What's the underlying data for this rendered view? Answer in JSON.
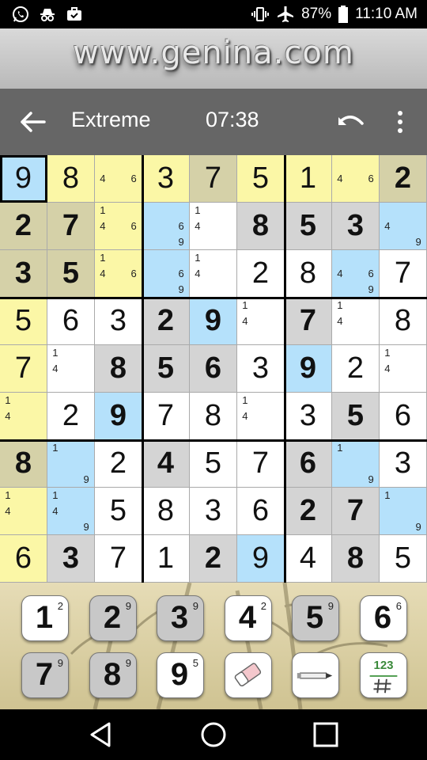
{
  "status_bar": {
    "battery": "87%",
    "time": "11:10 AM",
    "left_icons": [
      "whatsapp-icon",
      "incognito-icon",
      "briefcase-icon"
    ],
    "right_icons": [
      "vibrate-icon",
      "airplane-mode-icon",
      "battery-icon"
    ]
  },
  "banner": {
    "text": "www.genina.com"
  },
  "toolbar": {
    "level": "Extreme",
    "timer": "07:38"
  },
  "colors": {
    "yellow": "#fbf7a6",
    "olive": "#d5d1a8",
    "blue": "#b5e1fb",
    "gray": "#d4d4d4",
    "white": "#ffffff",
    "toolbar": "#666666",
    "selected_border": "#000000"
  },
  "board": {
    "selected": [
      0,
      0
    ],
    "rows": [
      [
        {
          "v": "9",
          "bg": "blue"
        },
        {
          "v": "8",
          "bg": "yellow"
        },
        {
          "n": [
            "4",
            "6"
          ],
          "bg": "yellow"
        },
        {
          "v": "3",
          "bg": "yellow"
        },
        {
          "v": "7",
          "bg": "olive"
        },
        {
          "v": "5",
          "bg": "yellow"
        },
        {
          "v": "1",
          "bg": "yellow"
        },
        {
          "n": [
            "4",
            "6"
          ],
          "bg": "yellow"
        },
        {
          "v": "2",
          "bg": "olive",
          "g": true
        }
      ],
      [
        {
          "v": "2",
          "bg": "olive",
          "g": true
        },
        {
          "v": "7",
          "bg": "olive",
          "g": true
        },
        {
          "n": [
            "1",
            "4",
            "6"
          ],
          "bg": "yellow"
        },
        {
          "n": [
            "6",
            "9"
          ],
          "bg": "blue"
        },
        {
          "n": [
            "1",
            "4"
          ],
          "bg": "white"
        },
        {
          "v": "8",
          "bg": "gray",
          "g": true
        },
        {
          "v": "5",
          "bg": "gray",
          "g": true
        },
        {
          "v": "3",
          "bg": "gray",
          "g": true
        },
        {
          "n": [
            "4",
            "9"
          ],
          "bg": "blue"
        }
      ],
      [
        {
          "v": "3",
          "bg": "olive",
          "g": true
        },
        {
          "v": "5",
          "bg": "olive",
          "g": true
        },
        {
          "n": [
            "1",
            "4",
            "6"
          ],
          "bg": "yellow"
        },
        {
          "n": [
            "6",
            "9"
          ],
          "bg": "blue"
        },
        {
          "n": [
            "1",
            "4"
          ],
          "bg": "white"
        },
        {
          "v": "2",
          "bg": "white"
        },
        {
          "v": "8",
          "bg": "white"
        },
        {
          "n": [
            "4",
            "6",
            "9"
          ],
          "bg": "blue"
        },
        {
          "v": "7",
          "bg": "white"
        }
      ],
      [
        {
          "v": "5",
          "bg": "yellow"
        },
        {
          "v": "6",
          "bg": "white"
        },
        {
          "v": "3",
          "bg": "white"
        },
        {
          "v": "2",
          "bg": "gray",
          "g": true
        },
        {
          "v": "9",
          "bg": "blue",
          "g": true
        },
        {
          "n": [
            "1",
            "4"
          ],
          "bg": "white"
        },
        {
          "v": "7",
          "bg": "gray",
          "g": true
        },
        {
          "n": [
            "1",
            "4"
          ],
          "bg": "white"
        },
        {
          "v": "8",
          "bg": "white"
        }
      ],
      [
        {
          "v": "7",
          "bg": "yellow"
        },
        {
          "n": [
            "1",
            "4"
          ],
          "bg": "white"
        },
        {
          "v": "8",
          "bg": "gray",
          "g": true
        },
        {
          "v": "5",
          "bg": "gray",
          "g": true
        },
        {
          "v": "6",
          "bg": "gray",
          "g": true
        },
        {
          "v": "3",
          "bg": "white"
        },
        {
          "v": "9",
          "bg": "blue",
          "g": true
        },
        {
          "v": "2",
          "bg": "white"
        },
        {
          "n": [
            "1",
            "4"
          ],
          "bg": "white"
        }
      ],
      [
        {
          "n": [
            "1",
            "4"
          ],
          "bg": "yellow"
        },
        {
          "v": "2",
          "bg": "white"
        },
        {
          "v": "9",
          "bg": "blue",
          "g": true
        },
        {
          "v": "7",
          "bg": "white"
        },
        {
          "v": "8",
          "bg": "white"
        },
        {
          "n": [
            "1",
            "4"
          ],
          "bg": "white"
        },
        {
          "v": "3",
          "bg": "white"
        },
        {
          "v": "5",
          "bg": "gray",
          "g": true
        },
        {
          "v": "6",
          "bg": "white"
        }
      ],
      [
        {
          "v": "8",
          "bg": "olive",
          "g": true
        },
        {
          "n": [
            "1",
            "9"
          ],
          "bg": "blue"
        },
        {
          "v": "2",
          "bg": "white"
        },
        {
          "v": "4",
          "bg": "gray",
          "g": true
        },
        {
          "v": "5",
          "bg": "white"
        },
        {
          "v": "7",
          "bg": "white"
        },
        {
          "v": "6",
          "bg": "gray",
          "g": true
        },
        {
          "n": [
            "1",
            "9"
          ],
          "bg": "blue"
        },
        {
          "v": "3",
          "bg": "white"
        }
      ],
      [
        {
          "n": [
            "1",
            "4"
          ],
          "bg": "yellow"
        },
        {
          "n": [
            "1",
            "4",
            "9"
          ],
          "bg": "blue"
        },
        {
          "v": "5",
          "bg": "white"
        },
        {
          "v": "8",
          "bg": "white"
        },
        {
          "v": "3",
          "bg": "white"
        },
        {
          "v": "6",
          "bg": "white"
        },
        {
          "v": "2",
          "bg": "gray",
          "g": true
        },
        {
          "v": "7",
          "bg": "gray",
          "g": true
        },
        {
          "n": [
            "1",
            "9"
          ],
          "bg": "blue"
        }
      ],
      [
        {
          "v": "6",
          "bg": "yellow"
        },
        {
          "v": "3",
          "bg": "gray",
          "g": true
        },
        {
          "v": "7",
          "bg": "white"
        },
        {
          "v": "1",
          "bg": "white"
        },
        {
          "v": "2",
          "bg": "gray",
          "g": true
        },
        {
          "v": "9",
          "bg": "blue"
        },
        {
          "v": "4",
          "bg": "white"
        },
        {
          "v": "8",
          "bg": "gray",
          "g": true
        },
        {
          "v": "5",
          "bg": "white"
        }
      ]
    ]
  },
  "keypad": {
    "digits": [
      {
        "d": "1",
        "c": "2",
        "dim": false
      },
      {
        "d": "2",
        "c": "9",
        "dim": true
      },
      {
        "d": "3",
        "c": "9",
        "dim": true
      },
      {
        "d": "4",
        "c": "2",
        "dim": false
      },
      {
        "d": "5",
        "c": "9",
        "dim": true
      },
      {
        "d": "6",
        "c": "6",
        "dim": false
      },
      {
        "d": "7",
        "c": "9",
        "dim": true
      },
      {
        "d": "8",
        "c": "9",
        "dim": true
      },
      {
        "d": "9",
        "c": "5",
        "dim": false
      }
    ],
    "tools": [
      {
        "icon": "eraser-icon"
      },
      {
        "icon": "pencil-icon"
      },
      {
        "icon": "number-mode-icon",
        "text": "123"
      }
    ]
  },
  "nav": {
    "icons": [
      "back-triangle-icon",
      "home-circle-icon",
      "recents-square-icon"
    ]
  }
}
